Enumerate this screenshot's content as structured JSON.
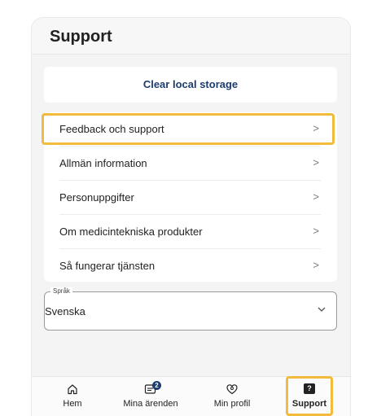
{
  "header": {
    "title": "Support"
  },
  "clear_storage": {
    "label": "Clear local storage"
  },
  "menu": {
    "items": [
      {
        "label": "Feedback och support",
        "chevron": ">"
      },
      {
        "label": "Allmän information",
        "chevron": ">"
      },
      {
        "label": "Personuppgifter",
        "chevron": ">"
      },
      {
        "label": "Om medicintekniska produkter",
        "chevron": ">"
      },
      {
        "label": "Så fungerar tjänsten",
        "chevron": ">"
      }
    ]
  },
  "language": {
    "legend": "Språk",
    "value": "Svenska",
    "icon": "chevron-down-icon"
  },
  "nav": {
    "items": [
      {
        "label": "Hem",
        "icon": "home-icon"
      },
      {
        "label": "Mina ärenden",
        "icon": "inbox-icon",
        "badge": "2"
      },
      {
        "label": "Min profil",
        "icon": "profile-icon"
      },
      {
        "label": "Support",
        "icon": "help-icon",
        "icon_glyph": "?"
      }
    ],
    "active": "Support"
  },
  "colors": {
    "accent": "#1d3c6e",
    "highlight": "#f2bb3c",
    "background": "#f4f4f4"
  }
}
